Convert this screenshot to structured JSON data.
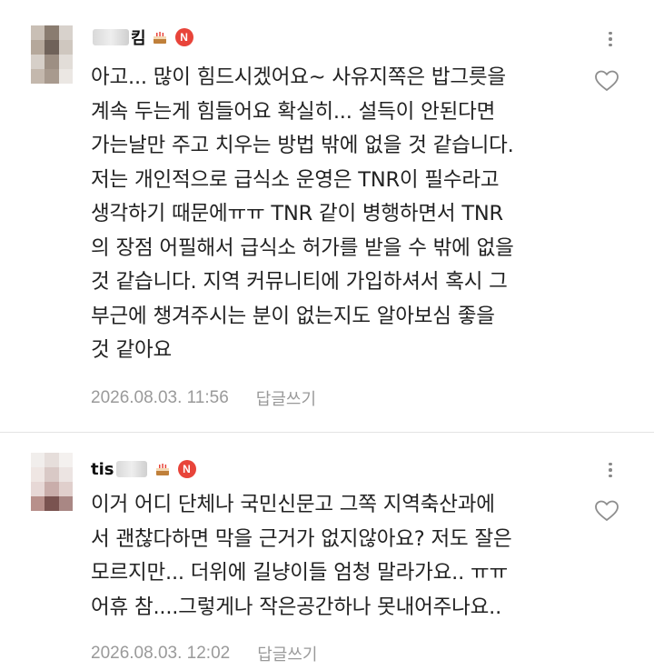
{
  "comments": [
    {
      "nickname": "킴",
      "badge": "N",
      "text": "아고... 많이 힘드시겠어요~ 사유지쪽은 밥그릇을 계속 두는게 힘들어요 확실히... 설득이 안된다면 가는날만 주고 치우는 방법 밖에 없을 것 같습니다. 저는 개인적으로 급식소 운영은 TNR이 필수라고 생각하기 때문에ㅠㅠ TNR 같이 병행하면서 TNR의 장점 어필해서 급식소 허가를 받을 수 밖에 없을 것 같습니다. 지역 커뮤니티에 가입하셔서 혹시 그 부근에 챙겨주시는 분이 없는지도 알아보심 좋을 것 같아요",
      "lines": [
        "아고... 많이 힘드시겠어요~ 사유지쪽은 밥그릇을",
        "계속 두는게 힘들어요 확실히... 설득이 안된다면",
        "가는날만 주고 치우는 방법 밖에 없을 것 같습니다.",
        "저는 개인적으로 급식소 운영은 TNR이 필수라고",
        "생각하기 때문에ㅠㅠ TNR 같이 병행하면서 TNR",
        "의 장점 어필해서 급식소 허가를 받을 수 밖에 없을",
        "것 같습니다. 지역 커뮤니티에 가입하셔서 혹시 그",
        "부근에 챙겨주시는 분이 없는지도 알아보심 좋을",
        "것 같아요"
      ],
      "date": "2026.08.03. 11:56",
      "reply_label": "답글쓰기"
    },
    {
      "nickname": "tis",
      "badge": "N",
      "lines": [
        "이거 어디 단체나 국민신문고 그쪽 지역축산과에",
        "서 괜찮다하면 막을 근거가 없지않아요? 저도 잘은",
        "모르지만... 더위에 길냥이들 엄청 말라가요.. ㅠㅠ",
        "어휴 참....그렇게나 작은공간하나 못내어주나요.."
      ],
      "date": "2026.08.03. 12:02",
      "reply_label": "답글쓰기"
    }
  ],
  "icons": {
    "more": "more-vertical-icon",
    "like": "heart-outline-icon",
    "badge": "cake-icon",
    "new": "new-badge"
  },
  "colors": {
    "badge_red": "#e8443a",
    "meta_gray": "#9a9a9a",
    "text": "#222222"
  }
}
